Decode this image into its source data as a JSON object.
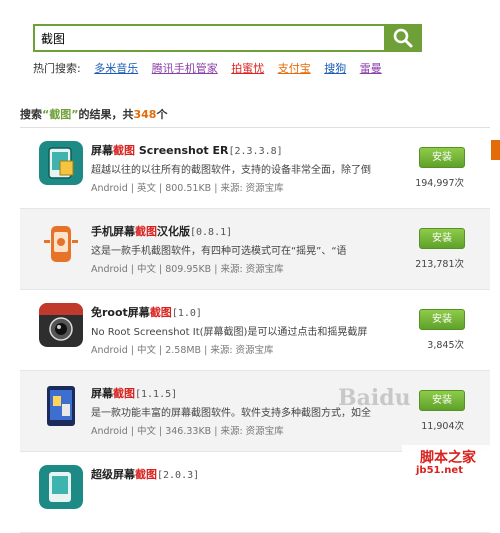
{
  "search": {
    "value": "截图"
  },
  "hot": {
    "label": "热门搜索:",
    "items": [
      {
        "label": "多米音乐",
        "color": "#1a5bb8"
      },
      {
        "label": "腾讯手机管家",
        "color": "#8a3fa8"
      },
      {
        "label": "拍蜜忧",
        "color": "#d8221e"
      },
      {
        "label": "支付宝",
        "color": "#e36c09"
      },
      {
        "label": "搜狗",
        "color": "#1a5bb8"
      },
      {
        "label": "雷曼",
        "color": "#8a3fa8"
      }
    ]
  },
  "results": {
    "prefix": "搜索",
    "keyword": "“截图”",
    "middle": "的结果，共",
    "count": "348",
    "suffix": "个"
  },
  "apps": [
    {
      "title_a": "屏幕",
      "title_hl": "截图",
      "title_b": " Screenshot ER",
      "version": "[2.3.3.8]",
      "desc": "超越以往的以往所有的截图软件，支持的设备非常全面，除了倒",
      "meta": "Android | 英文 | 800.51KB | 来源: 资源宝库",
      "install": "安装",
      "downloads": "194,997次"
    },
    {
      "title_a": "手机屏幕",
      "title_hl": "截图",
      "title_b": "汉化版",
      "version": "[0.8.1]",
      "desc": "这是一款手机截图软件，有四种可选模式可在“摇晃”、“语",
      "meta": "Android | 中文 | 809.95KB | 来源: 资源宝库",
      "install": "安装",
      "downloads": "213,781次"
    },
    {
      "title_a": "免root屏幕",
      "title_hl": "截图",
      "title_b": "",
      "version": "[1.0]",
      "desc": "No Root Screenshot It(屏幕截图)是可以通过点击和摇晃截屏",
      "meta": "Android | 中文 | 2.58MB | 来源: 资源宝库",
      "install": "安装",
      "downloads": "3,845次"
    },
    {
      "title_a": "屏幕",
      "title_hl": "截图",
      "title_b": "",
      "version": "[1.1.5]",
      "desc": "是一款功能丰富的屏幕截图软件。软件支持多种截图方式，如全",
      "meta": "Android | 中文 | 346.33KB | 来源: 资源宝库",
      "install": "安装",
      "downloads": "11,904次"
    },
    {
      "title_a": "超级屏幕",
      "title_hl": "截图",
      "title_b": "",
      "version": "[2.0.3]",
      "desc": "",
      "meta": "",
      "install": "",
      "downloads": ""
    }
  ],
  "watermark": {
    "baidu": "Baidu",
    "site1": "脚本之家",
    "site2": "jb51.net"
  }
}
